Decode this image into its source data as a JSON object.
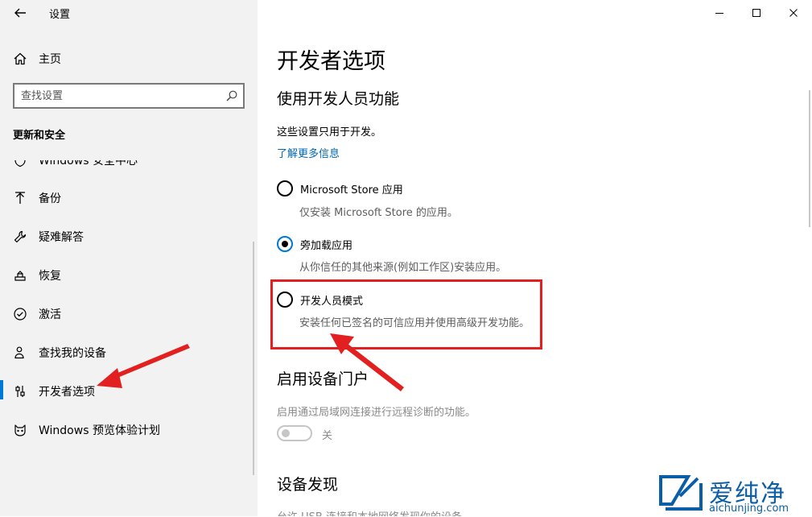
{
  "app": {
    "title": "设置"
  },
  "sidebar": {
    "home_label": "主页",
    "search_placeholder": "查找设置",
    "section_header": "更新和安全",
    "items": [
      {
        "label": "Windows 安全中心",
        "icon": "shield-icon"
      },
      {
        "label": "备份",
        "icon": "backup-arrow-icon"
      },
      {
        "label": "疑难解答",
        "icon": "wrench-icon"
      },
      {
        "label": "恢复",
        "icon": "recovery-icon"
      },
      {
        "label": "激活",
        "icon": "check-circle-icon"
      },
      {
        "label": "查找我的设备",
        "icon": "person-location-icon"
      },
      {
        "label": "开发者选项",
        "icon": "developer-sliders-icon",
        "active": true
      },
      {
        "label": "Windows 预览体验计划",
        "icon": "insider-cat-icon"
      }
    ]
  },
  "main": {
    "title": "开发者选项",
    "use_features": {
      "heading": "使用开发人员功能",
      "description": "这些设置只用于开发。",
      "link": "了解更多信息",
      "options": [
        {
          "label": "Microsoft Store 应用",
          "sublabel": "仅安装 Microsoft Store 的应用。",
          "checked": false
        },
        {
          "label": "旁加载应用",
          "sublabel": "从你信任的其他来源(例如工作区)安装应用。",
          "checked": true
        },
        {
          "label": "开发人员模式",
          "sublabel": "安装任何已签名的可信应用并使用高级开发功能。",
          "checked": false
        }
      ]
    },
    "device_portal": {
      "heading": "启用设备门户",
      "description": "启用通过局域网连接进行远程诊断的功能。",
      "toggle_label": "关",
      "toggle_on": false
    },
    "device_discovery": {
      "heading": "设备发现",
      "description": "允许 USB 连接和本地网络发现你的设备。"
    }
  },
  "watermark": {
    "brand": "爱纯净",
    "domain": "aichunjing.com"
  },
  "colors": {
    "accent": "#0078d7",
    "link": "#0067b8",
    "annotation": "#e22020",
    "sidebar_bg": "#f2f2f2"
  }
}
